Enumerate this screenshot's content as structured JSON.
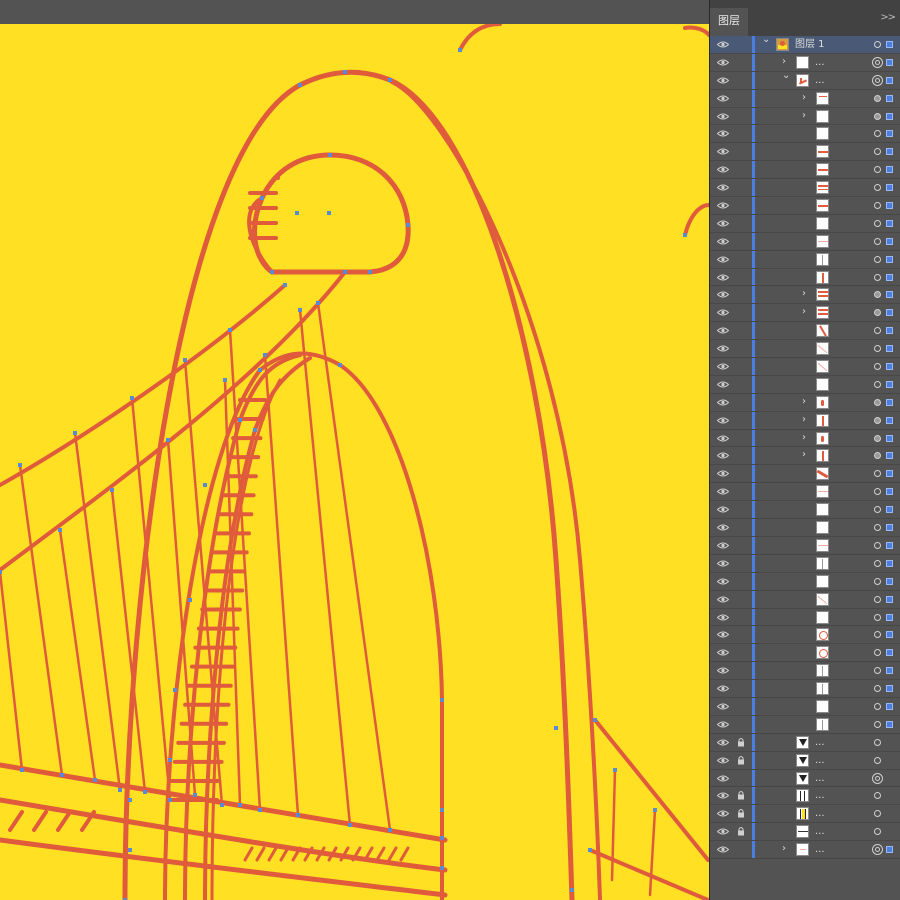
{
  "panel": {
    "tab_label": "图层",
    "menu_glyph": ">>",
    "colors": {
      "selection_square": "#4a7ee0",
      "layer_color_bar": "#4a7ee0",
      "selected_row": "#4a5a76"
    }
  },
  "artboard": {
    "background": "#ffe022",
    "stroke": "#e05a3c",
    "anchor": "#5a8ad6"
  },
  "layers": [
    {
      "name": "图层 1",
      "level": 0,
      "expand": "open",
      "thumb": "photo",
      "target": "dot",
      "selected": true,
      "lock": false
    },
    {
      "name": "...",
      "level": 1,
      "expand": "closed",
      "thumb": "blank",
      "target": "ring",
      "selected": false,
      "lock": false
    },
    {
      "name": "...",
      "level": 1,
      "expand": "open",
      "thumb": "curve",
      "target": "ring",
      "selected": false,
      "lock": false
    },
    {
      "name": "",
      "level": 2,
      "expand": "closed",
      "thumb": "hline-top",
      "target": "filled",
      "selected": false,
      "lock": false
    },
    {
      "name": "",
      "level": 2,
      "expand": "closed",
      "thumb": "blank",
      "target": "filled",
      "selected": false,
      "lock": false
    },
    {
      "name": "",
      "level": 2,
      "expand": "none",
      "thumb": "blank",
      "target": "dot",
      "selected": false,
      "lock": false
    },
    {
      "name": "",
      "level": 2,
      "expand": "none",
      "thumb": "hline",
      "target": "dot",
      "selected": false,
      "lock": false
    },
    {
      "name": "",
      "level": 2,
      "expand": "none",
      "thumb": "hline",
      "target": "dot",
      "selected": false,
      "lock": false
    },
    {
      "name": "",
      "level": 2,
      "expand": "none",
      "thumb": "hline2",
      "target": "dot",
      "selected": false,
      "lock": false
    },
    {
      "name": "",
      "level": 2,
      "expand": "none",
      "thumb": "hline",
      "target": "dot",
      "selected": false,
      "lock": false
    },
    {
      "name": "",
      "level": 2,
      "expand": "none",
      "thumb": "blank",
      "target": "dot",
      "selected": false,
      "lock": false
    },
    {
      "name": "",
      "level": 2,
      "expand": "none",
      "thumb": "hline-faint",
      "target": "dot",
      "selected": false,
      "lock": false
    },
    {
      "name": "",
      "level": 2,
      "expand": "none",
      "thumb": "vline",
      "target": "dot",
      "selected": false,
      "lock": false
    },
    {
      "name": "",
      "level": 2,
      "expand": "none",
      "thumb": "vline-red",
      "target": "dot",
      "selected": false,
      "lock": false
    },
    {
      "name": "",
      "level": 2,
      "expand": "closed",
      "thumb": "ladder",
      "target": "filled",
      "selected": false,
      "lock": false
    },
    {
      "name": "",
      "level": 2,
      "expand": "closed",
      "thumb": "ladder",
      "target": "filled",
      "selected": false,
      "lock": false
    },
    {
      "name": "",
      "level": 2,
      "expand": "none",
      "thumb": "diag",
      "target": "dot",
      "selected": false,
      "lock": false
    },
    {
      "name": "",
      "level": 2,
      "expand": "none",
      "thumb": "diag-faint",
      "target": "dot",
      "selected": false,
      "lock": false
    },
    {
      "name": "",
      "level": 2,
      "expand": "none",
      "thumb": "diag-faint",
      "target": "dot",
      "selected": false,
      "lock": false
    },
    {
      "name": "",
      "level": 2,
      "expand": "none",
      "thumb": "blank",
      "target": "dot",
      "selected": false,
      "lock": false
    },
    {
      "name": "",
      "level": 2,
      "expand": "closed",
      "thumb": "curve-small",
      "target": "filled",
      "selected": false,
      "lock": false
    },
    {
      "name": "",
      "level": 2,
      "expand": "closed",
      "thumb": "vline-red",
      "target": "filled",
      "selected": false,
      "lock": false
    },
    {
      "name": "",
      "level": 2,
      "expand": "closed",
      "thumb": "curve-small",
      "target": "filled",
      "selected": false,
      "lock": false
    },
    {
      "name": "",
      "level": 2,
      "expand": "closed",
      "thumb": "vline-red",
      "target": "filled",
      "selected": false,
      "lock": false
    },
    {
      "name": "",
      "level": 2,
      "expand": "none",
      "thumb": "diag-thick",
      "target": "dot",
      "selected": false,
      "lock": false
    },
    {
      "name": "",
      "level": 2,
      "expand": "none",
      "thumb": "hline-faint",
      "target": "dot",
      "selected": false,
      "lock": false
    },
    {
      "name": "",
      "level": 2,
      "expand": "none",
      "thumb": "blank",
      "target": "dot",
      "selected": false,
      "lock": false
    },
    {
      "name": "",
      "level": 2,
      "expand": "none",
      "thumb": "blank",
      "target": "dot",
      "selected": false,
      "lock": false
    },
    {
      "name": "",
      "level": 2,
      "expand": "none",
      "thumb": "hline-faint",
      "target": "dot",
      "selected": false,
      "lock": false
    },
    {
      "name": "",
      "level": 2,
      "expand": "none",
      "thumb": "vline",
      "target": "dot",
      "selected": false,
      "lock": false
    },
    {
      "name": "",
      "level": 2,
      "expand": "none",
      "thumb": "blank",
      "target": "dot",
      "selected": false,
      "lock": false
    },
    {
      "name": "",
      "level": 2,
      "expand": "none",
      "thumb": "diag-faint",
      "target": "dot",
      "selected": false,
      "lock": false
    },
    {
      "name": "",
      "level": 2,
      "expand": "none",
      "thumb": "blank",
      "target": "dot",
      "selected": false,
      "lock": false
    },
    {
      "name": "",
      "level": 2,
      "expand": "none",
      "thumb": "arc",
      "target": "dot",
      "selected": false,
      "lock": false
    },
    {
      "name": "",
      "level": 2,
      "expand": "none",
      "thumb": "arc",
      "target": "dot",
      "selected": false,
      "lock": false
    },
    {
      "name": "",
      "level": 2,
      "expand": "none",
      "thumb": "vline",
      "target": "dot",
      "selected": false,
      "lock": false
    },
    {
      "name": "",
      "level": 2,
      "expand": "none",
      "thumb": "vline",
      "target": "dot",
      "selected": false,
      "lock": false
    },
    {
      "name": "",
      "level": 2,
      "expand": "none",
      "thumb": "blank",
      "target": "dot",
      "selected": false,
      "lock": false
    },
    {
      "name": "",
      "level": 2,
      "expand": "none",
      "thumb": "vline",
      "target": "dot",
      "selected": false,
      "lock": false
    },
    {
      "name": "...",
      "level": 1,
      "expand": "none",
      "thumb": "triangle",
      "target": "dot",
      "selected": false,
      "lock": true
    },
    {
      "name": "...",
      "level": 1,
      "expand": "none",
      "thumb": "triangle",
      "target": "dot",
      "selected": false,
      "lock": true
    },
    {
      "name": "...",
      "level": 1,
      "expand": "none",
      "thumb": "triangle",
      "target": "ring",
      "selected": false,
      "lock": false
    },
    {
      "name": "...",
      "level": 1,
      "expand": "none",
      "thumb": "bars",
      "target": "dot",
      "selected": false,
      "lock": true
    },
    {
      "name": "...",
      "level": 1,
      "expand": "none",
      "thumb": "bars-yellow",
      "target": "dot",
      "selected": false,
      "lock": true
    },
    {
      "name": "...",
      "level": 1,
      "expand": "none",
      "thumb": "hline-dark",
      "target": "dot",
      "selected": false,
      "lock": true
    },
    {
      "name": "...",
      "level": 1,
      "expand": "closed",
      "thumb": "curve-faint",
      "target": "ring",
      "selected": false,
      "lock": false
    }
  ]
}
